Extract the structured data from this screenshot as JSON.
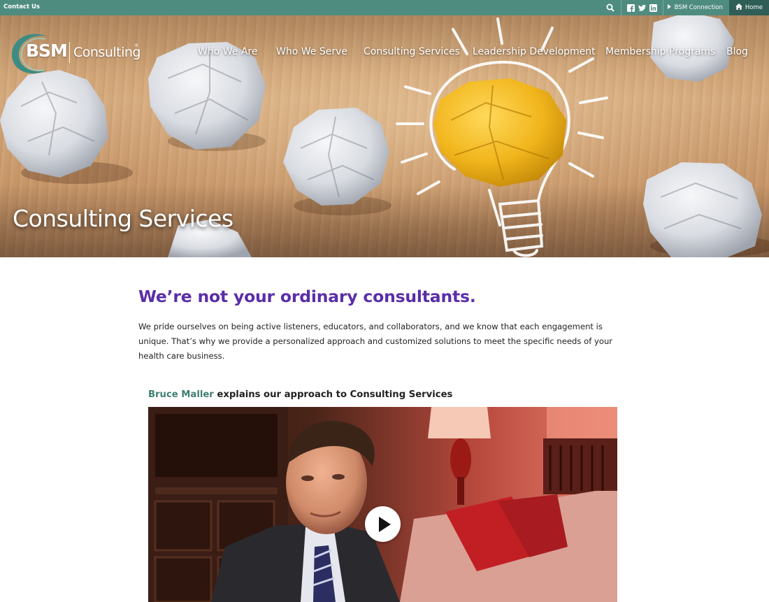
{
  "topbar": {
    "contact_label": "Contact Us",
    "connection_label": "BSM Connection",
    "home_label": "Home",
    "icons": [
      "search-icon",
      "facebook-icon",
      "twitter-icon",
      "linkedin-icon",
      "caret-right-icon",
      "home-icon"
    ]
  },
  "logo": {
    "bsm": "BSM",
    "consulting": "Consulting",
    "reg": "®"
  },
  "nav": {
    "items": [
      {
        "label": "Who We Are"
      },
      {
        "label": "Who We Serve"
      },
      {
        "label": "Consulting Services"
      },
      {
        "label": "Leadership Development"
      },
      {
        "label": "Membership Programs"
      },
      {
        "label": "Blog"
      }
    ]
  },
  "hero": {
    "title": "Consulting Services"
  },
  "intro": {
    "heading": "We’re not your ordinary consultants.",
    "body": "We pride ourselves on being active listeners, educators, and collaborators, and we know that each engagement is unique. That’s why we provide a personalized approach and customized solutions to meet the specific needs of your health care business."
  },
  "video": {
    "caption_name": "Bruce Maller",
    "caption_rest": " explains our approach to Consulting Services"
  },
  "colors": {
    "topbar": "#4f8c80",
    "topbar_home": "#2f5e56",
    "heading_purple": "#5a2ea8",
    "name_teal": "#3f7d74"
  }
}
